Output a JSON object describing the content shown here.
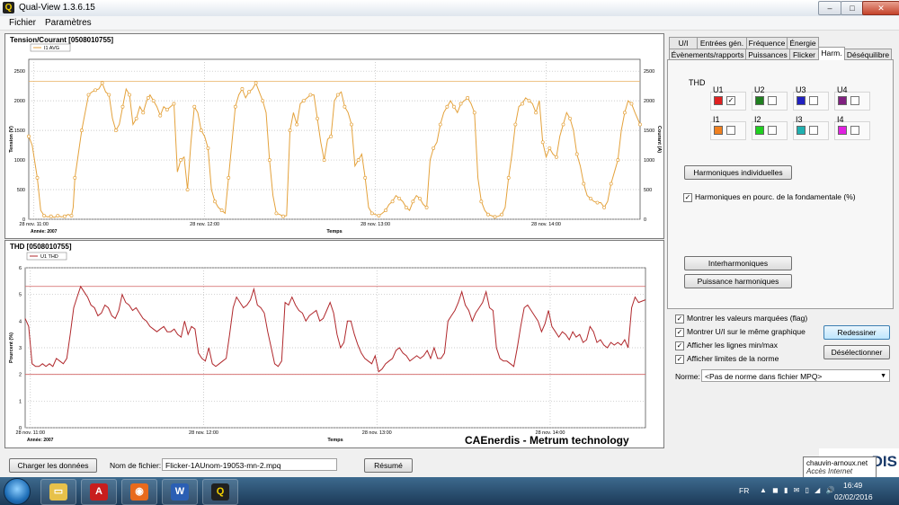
{
  "window": {
    "title": "Qual-View 1.3.6.15",
    "app_icon_glyph": "Q",
    "minimize": "–",
    "maximize": "□",
    "close": "✕"
  },
  "menu": [
    "Fichier",
    "Paramètres"
  ],
  "chart1": {
    "title": "Tension/Courant  [0508010755]",
    "legend": "I1 AVG",
    "y_left_label": "Tension (V)",
    "y_right_label": "Courant (A)",
    "x_label": "Temps",
    "year_label": "Année: 2007",
    "x_ticks": [
      "28 nov. 11:00",
      "28 nov. 12:00",
      "28 nov. 13:00",
      "28 nov. 14:00"
    ],
    "y_left_ticks": [
      "0",
      "500",
      "1000",
      "1500",
      "2000",
      "2500"
    ],
    "y_right_ticks": [
      "0",
      "500",
      "1000",
      "1500",
      "2000",
      "2500"
    ]
  },
  "chart2": {
    "title": "THD  [0508010755]",
    "legend": "U1 THD",
    "y_label": "Pourcent (%)",
    "x_label": "Temps",
    "year_label": "Année: 2007",
    "x_ticks": [
      "28 nov. 11:00",
      "28 nov. 12:00",
      "28 nov. 13:00",
      "28 nov. 14:00"
    ],
    "y_ticks": [
      "0",
      "1",
      "2",
      "3",
      "4",
      "5",
      "6"
    ]
  },
  "chart_data": [
    {
      "type": "line",
      "title": "Tension/Courant  [0508010755]",
      "xlabel": "Temps",
      "ylabel": "Tension (V)",
      "y2label": "Courant (A)",
      "x_ticks": [
        "28 nov. 11:00",
        "28 nov. 12:00",
        "28 nov. 13:00",
        "28 nov. 14:00"
      ],
      "x_range_hours": [
        10.97,
        14.55
      ],
      "ylim": [
        0,
        2700
      ],
      "limit_line": 2330,
      "legend": "top-left",
      "grid": true,
      "series": [
        {
          "name": "I1 AVG",
          "color": "#e4a23c",
          "x_hours": [
            10.97,
            10.99,
            11.02,
            11.04,
            11.06,
            11.08,
            11.1,
            11.12,
            11.14,
            11.16,
            11.18,
            11.2,
            11.22,
            11.23,
            11.24,
            11.26,
            11.28,
            11.3,
            11.32,
            11.34,
            11.36,
            11.38,
            11.4,
            11.42,
            11.44,
            11.46,
            11.48,
            11.5,
            11.52,
            11.54,
            11.56,
            11.58,
            11.6,
            11.62,
            11.64,
            11.66,
            11.67,
            11.68,
            11.7,
            11.72,
            11.74,
            11.76,
            11.78,
            11.8,
            11.82,
            11.84,
            11.86,
            11.88,
            11.9,
            11.92,
            11.94,
            11.96,
            11.98,
            12.0,
            12.02,
            12.04,
            12.06,
            12.08,
            12.1,
            12.12,
            12.14,
            12.16,
            12.18,
            12.2,
            12.22,
            12.24,
            12.26,
            12.28,
            12.3,
            12.32,
            12.34,
            12.36,
            12.38,
            12.4,
            12.42,
            12.44,
            12.46,
            12.48,
            12.5,
            12.52,
            12.54,
            12.56,
            12.58,
            12.6,
            12.62,
            12.64,
            12.66,
            12.68,
            12.7,
            12.72,
            12.74,
            12.76,
            12.78,
            12.8,
            12.82,
            12.84,
            12.86,
            12.88,
            12.9,
            12.92,
            12.94,
            12.96,
            12.98,
            13.0,
            13.02,
            13.04,
            13.06,
            13.08,
            13.1,
            13.12,
            13.14,
            13.16,
            13.18,
            13.2,
            13.22,
            13.24,
            13.26,
            13.28,
            13.3,
            13.32,
            13.34,
            13.36,
            13.38,
            13.4,
            13.42,
            13.44,
            13.46,
            13.48,
            13.5,
            13.52,
            13.54,
            13.56,
            13.58,
            13.6,
            13.62,
            13.64,
            13.66,
            13.68,
            13.7,
            13.72,
            13.74,
            13.76,
            13.78,
            13.8,
            13.82,
            13.84,
            13.86,
            13.88,
            13.9,
            13.92,
            13.94,
            13.96,
            13.98,
            14.0,
            14.02,
            14.04,
            14.06,
            14.08,
            14.1,
            14.12,
            14.14,
            14.16,
            14.18,
            14.2,
            14.22,
            14.24,
            14.26,
            14.28,
            14.3,
            14.32,
            14.34,
            14.36,
            14.38,
            14.4,
            14.42,
            14.44,
            14.46,
            14.48,
            14.5,
            14.52,
            14.55
          ],
          "values": [
            1400,
            1250,
            700,
            150,
            60,
            40,
            50,
            30,
            60,
            40,
            50,
            80,
            60,
            200,
            700,
            1100,
            1500,
            1800,
            2100,
            2150,
            2180,
            2200,
            2300,
            2150,
            2100,
            1700,
            1500,
            1600,
            1900,
            2200,
            2100,
            1600,
            1700,
            1900,
            1800,
            2000,
            2050,
            2100,
            2000,
            1900,
            1750,
            1900,
            1850,
            1900,
            1950,
            800,
            1000,
            1050,
            500,
            1300,
            1900,
            1800,
            1500,
            1400,
            1200,
            500,
            300,
            200,
            150,
            100,
            700,
            1300,
            1900,
            2100,
            2200,
            2050,
            2150,
            2200,
            2300,
            2150,
            2000,
            1800,
            1000,
            400,
            100,
            80,
            50,
            60,
            1500,
            1800,
            1600,
            1950,
            2000,
            2050,
            2100,
            2100,
            1700,
            1300,
            1000,
            1350,
            1400,
            2000,
            2100,
            2150,
            1900,
            1800,
            1600,
            900,
            1000,
            1100,
            700,
            200,
            100,
            80,
            60,
            100,
            150,
            250,
            300,
            400,
            350,
            300,
            200,
            150,
            300,
            400,
            350,
            250,
            200,
            1000,
            1200,
            1300,
            1600,
            1800,
            1900,
            2000,
            1900,
            1800,
            1950,
            2000,
            2050,
            1950,
            1800,
            700,
            300,
            150,
            80,
            60,
            40,
            50,
            80,
            200,
            700,
            1100,
            1600,
            1900,
            1950,
            2050,
            2000,
            1950,
            1800,
            2000,
            1300,
            1050,
            1200,
            1100,
            1050,
            1400,
            1600,
            1800,
            1700,
            1500,
            1100,
            900,
            600,
            400,
            350,
            300,
            280,
            280,
            200,
            300,
            600,
            800,
            1000,
            1500,
            1800,
            2000,
            1950,
            1800,
            1600,
            1800,
            2000
          ]
        }
      ]
    },
    {
      "type": "line",
      "title": "THD  [0508010755]",
      "xlabel": "Temps",
      "ylabel": "Pourcent (%)",
      "x_ticks": [
        "28 nov. 11:00",
        "28 nov. 12:00",
        "28 nov. 13:00",
        "28 nov. 14:00"
      ],
      "x_range_hours": [
        10.97,
        14.55
      ],
      "ylim": [
        0,
        6
      ],
      "limit_lines": [
        5.3,
        2.0
      ],
      "legend": "top-left",
      "grid": true,
      "series": [
        {
          "name": "U1 THD",
          "color": "#b0282c",
          "x_hours": [
            10.97,
            10.99,
            11.01,
            11.03,
            11.05,
            11.07,
            11.09,
            11.11,
            11.13,
            11.15,
            11.17,
            11.19,
            11.21,
            11.23,
            11.25,
            11.27,
            11.29,
            11.31,
            11.33,
            11.35,
            11.37,
            11.39,
            11.41,
            11.43,
            11.45,
            11.47,
            11.49,
            11.51,
            11.53,
            11.55,
            11.57,
            11.59,
            11.61,
            11.63,
            11.65,
            11.67,
            11.69,
            11.71,
            11.73,
            11.75,
            11.77,
            11.79,
            11.81,
            11.83,
            11.85,
            11.87,
            11.89,
            11.91,
            11.93,
            11.95,
            11.97,
            11.99,
            12.01,
            12.03,
            12.05,
            12.07,
            12.09,
            12.11,
            12.13,
            12.15,
            12.17,
            12.19,
            12.21,
            12.23,
            12.25,
            12.27,
            12.29,
            12.31,
            12.33,
            12.35,
            12.37,
            12.39,
            12.41,
            12.43,
            12.45,
            12.47,
            12.49,
            12.51,
            12.53,
            12.55,
            12.57,
            12.59,
            12.61,
            12.63,
            12.65,
            12.67,
            12.69,
            12.71,
            12.73,
            12.75,
            12.77,
            12.79,
            12.81,
            12.83,
            12.85,
            12.87,
            12.89,
            12.91,
            12.93,
            12.95,
            12.97,
            12.99,
            13.01,
            13.03,
            13.05,
            13.07,
            13.09,
            13.11,
            13.13,
            13.15,
            13.17,
            13.19,
            13.21,
            13.23,
            13.25,
            13.27,
            13.29,
            13.31,
            13.33,
            13.35,
            13.37,
            13.39,
            13.41,
            13.43,
            13.45,
            13.47,
            13.49,
            13.51,
            13.53,
            13.55,
            13.57,
            13.59,
            13.61,
            13.63,
            13.65,
            13.67,
            13.69,
            13.71,
            13.73,
            13.75,
            13.77,
            13.79,
            13.81,
            13.83,
            13.85,
            13.87,
            13.89,
            13.91,
            13.93,
            13.95,
            13.97,
            13.99,
            14.01,
            14.03,
            14.05,
            14.07,
            14.09,
            14.11,
            14.13,
            14.15,
            14.17,
            14.19,
            14.21,
            14.23,
            14.25,
            14.27,
            14.29,
            14.31,
            14.33,
            14.35,
            14.37,
            14.39,
            14.41,
            14.43,
            14.45,
            14.47,
            14.49,
            14.51,
            14.55
          ],
          "values": [
            4.1,
            3.8,
            2.4,
            2.3,
            2.3,
            2.4,
            2.3,
            2.4,
            2.3,
            2.6,
            2.5,
            2.4,
            2.6,
            3.5,
            4.5,
            4.9,
            5.3,
            5.1,
            4.9,
            4.6,
            4.5,
            4.2,
            4.3,
            4.6,
            4.5,
            4.2,
            4.1,
            4.4,
            5.0,
            4.7,
            4.6,
            4.4,
            4.5,
            4.3,
            4.1,
            4.0,
            3.8,
            3.7,
            3.6,
            3.7,
            3.8,
            3.6,
            3.6,
            3.7,
            3.5,
            3.4,
            4.0,
            3.5,
            3.8,
            3.7,
            2.8,
            2.6,
            2.5,
            3.0,
            2.4,
            2.3,
            2.4,
            2.5,
            2.6,
            3.5,
            4.5,
            4.9,
            4.7,
            4.5,
            4.6,
            4.8,
            5.2,
            4.6,
            4.5,
            4.3,
            3.6,
            3.0,
            2.4,
            2.3,
            2.5,
            4.7,
            4.6,
            4.9,
            4.6,
            4.4,
            4.3,
            4.0,
            4.2,
            4.3,
            4.4,
            4.0,
            4.1,
            4.4,
            4.7,
            4.3,
            3.5,
            3.0,
            3.2,
            4.0,
            4.0,
            3.5,
            3.1,
            2.8,
            2.6,
            2.5,
            2.4,
            2.7,
            2.1,
            2.2,
            2.4,
            2.5,
            2.6,
            2.9,
            3.0,
            2.8,
            2.7,
            2.5,
            2.6,
            2.7,
            2.6,
            2.7,
            2.9,
            2.6,
            3.0,
            2.6,
            2.6,
            2.8,
            4.0,
            4.2,
            4.4,
            4.7,
            5.1,
            4.6,
            4.4,
            4.0,
            4.3,
            4.5,
            4.7,
            5.1,
            4.5,
            4.4,
            3.0,
            2.6,
            2.5,
            2.5,
            2.4,
            2.3,
            3.0,
            3.8,
            4.5,
            4.6,
            4.4,
            4.2,
            4.0,
            3.6,
            3.9,
            4.4,
            3.8,
            3.6,
            3.4,
            3.6,
            3.5,
            3.3,
            3.6,
            3.4,
            3.5,
            3.2,
            3.3,
            3.8,
            3.6,
            3.2,
            3.3,
            3.1,
            3.0,
            3.2,
            3.1,
            3.2,
            3.1,
            3.3,
            3.0,
            4.5,
            4.9,
            4.7,
            4.8,
            4.9,
            4.4,
            4.9
          ]
        }
      ]
    }
  ],
  "tabs_row1": [
    "U/I",
    "Entrées gén.",
    "Fréquence",
    "Énergie"
  ],
  "tabs_row2": [
    "Évènements/rapports",
    "Puissances",
    "Flicker",
    "Harm.",
    "Déséquilibre"
  ],
  "thd": {
    "label": "THD",
    "cells": [
      {
        "name": "U1",
        "color": "#e02020",
        "checked": "✓"
      },
      {
        "name": "U2",
        "color": "#208020",
        "checked": ""
      },
      {
        "name": "U3",
        "color": "#2020c0",
        "checked": ""
      },
      {
        "name": "U4",
        "color": "#802080",
        "checked": ""
      },
      {
        "name": "I1",
        "color": "#f08020",
        "checked": ""
      },
      {
        "name": "I2",
        "color": "#20d020",
        "checked": ""
      },
      {
        "name": "I3",
        "color": "#20b0b0",
        "checked": ""
      },
      {
        "name": "I4",
        "color": "#e020e0",
        "checked": ""
      }
    ]
  },
  "buttons": {
    "harm_individual": "Harmoniques individuelles",
    "interharmonics": "Interharmoniques",
    "harm_power": "Puissance harmoniques",
    "redraw": "Redessiner",
    "deselect": "Désélectionner",
    "load_data": "Charger les données",
    "summary": "Résumé"
  },
  "harm_percent_label": "Harmoniques en pourc. de la fondamentale (%)",
  "options": [
    "Montrer les valeurs marquées (flag)",
    "Montrer U/I sur le même graphique",
    "Afficher les lignes min/max",
    "Afficher limites de la norme"
  ],
  "norm": {
    "label": "Norme:",
    "value": "<Pas de norme dans fichier MPQ>"
  },
  "file": {
    "label": "Nom de fichier:",
    "value": "Flicker-1AUnom-19053-mn-2.mpq"
  },
  "watermark": "CAEnerdis - Metrum technology",
  "tooltip": {
    "line1": "chauvin-arnoux.net",
    "line2": "Accès Internet"
  },
  "corner_logo_text": "DIS",
  "taskbar": {
    "lang": "FR",
    "time": "16:49",
    "date": "02/02/2016",
    "apps": [
      "explorer-icon",
      "acrobat-icon",
      "firefox-icon",
      "word-icon",
      "qualview-icon"
    ],
    "app_glyphs": [
      "▭",
      "A",
      "◉",
      "W",
      "Q"
    ],
    "app_colors": [
      "#e7c14a",
      "#c81e1e",
      "#e86a1c",
      "#2b5fb4",
      "#202020"
    ],
    "tray_icons": "▲ ◼ ▮ ✉ ▯ ◢ 🔊"
  }
}
